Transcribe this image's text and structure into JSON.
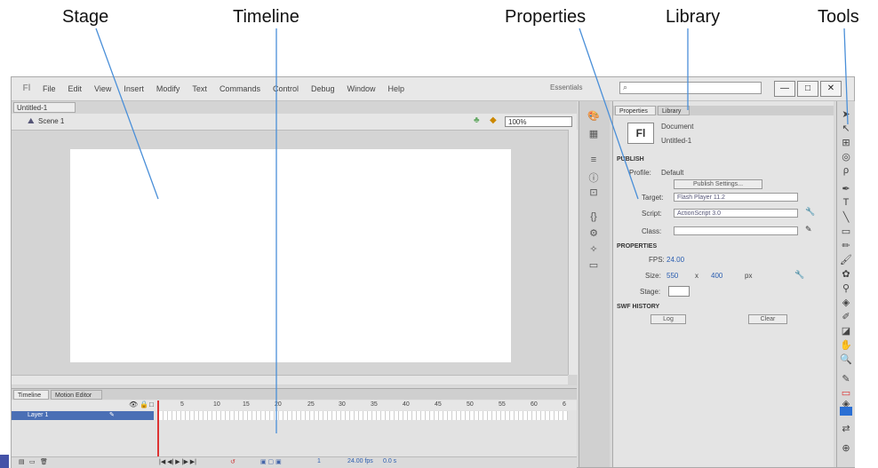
{
  "annotations": {
    "stage": "Stage",
    "timeline": "Timeline",
    "properties": "Properties",
    "library": "Library",
    "tools": "Tools"
  },
  "menu": [
    "File",
    "Edit",
    "View",
    "Insert",
    "Modify",
    "Text",
    "Commands",
    "Control",
    "Debug",
    "Window",
    "Help"
  ],
  "workspace": "Essentials",
  "window_buttons": [
    "—",
    "□",
    "✕"
  ],
  "document": {
    "tab": "Untitled-1",
    "scene": "Scene 1",
    "zoom": "100%"
  },
  "timeline": {
    "tabs": [
      "Timeline",
      "Motion Editor"
    ],
    "frame_numbers": [
      "5",
      "10",
      "15",
      "20",
      "25",
      "30",
      "35",
      "40",
      "45",
      "50",
      "55",
      "60",
      "6"
    ],
    "layer": "Layer 1",
    "fps_readout": "24.00 fps",
    "time_readout": "0.0 s",
    "current_frame": "1"
  },
  "properties": {
    "tabs": [
      "Properties",
      "Library"
    ],
    "doc_type": "Document",
    "doc_name": "Untitled-1",
    "fl_badge": "Fl",
    "publish_section": "PUBLISH",
    "profile_label": "Profile:",
    "profile_value": "Default",
    "publish_settings_btn": "Publish Settings...",
    "target_label": "Target:",
    "target_value": "Flash Player 11.2",
    "script_label": "Script:",
    "script_value": "ActionScript 3.0",
    "class_label": "Class:",
    "properties_section": "PROPERTIES",
    "fps_label": "FPS:",
    "fps_value": "24.00",
    "size_label": "Size:",
    "width": "550",
    "x_sep": "x",
    "height": "400",
    "px": "px",
    "stage_label": "Stage:",
    "history_section": "SWF HISTORY",
    "log_btn": "Log",
    "clear_btn": "Clear"
  },
  "colors": {
    "accent": "#4a6fb5",
    "fill_swatch": "#2a6fd4",
    "playhead": "#dd3333"
  }
}
